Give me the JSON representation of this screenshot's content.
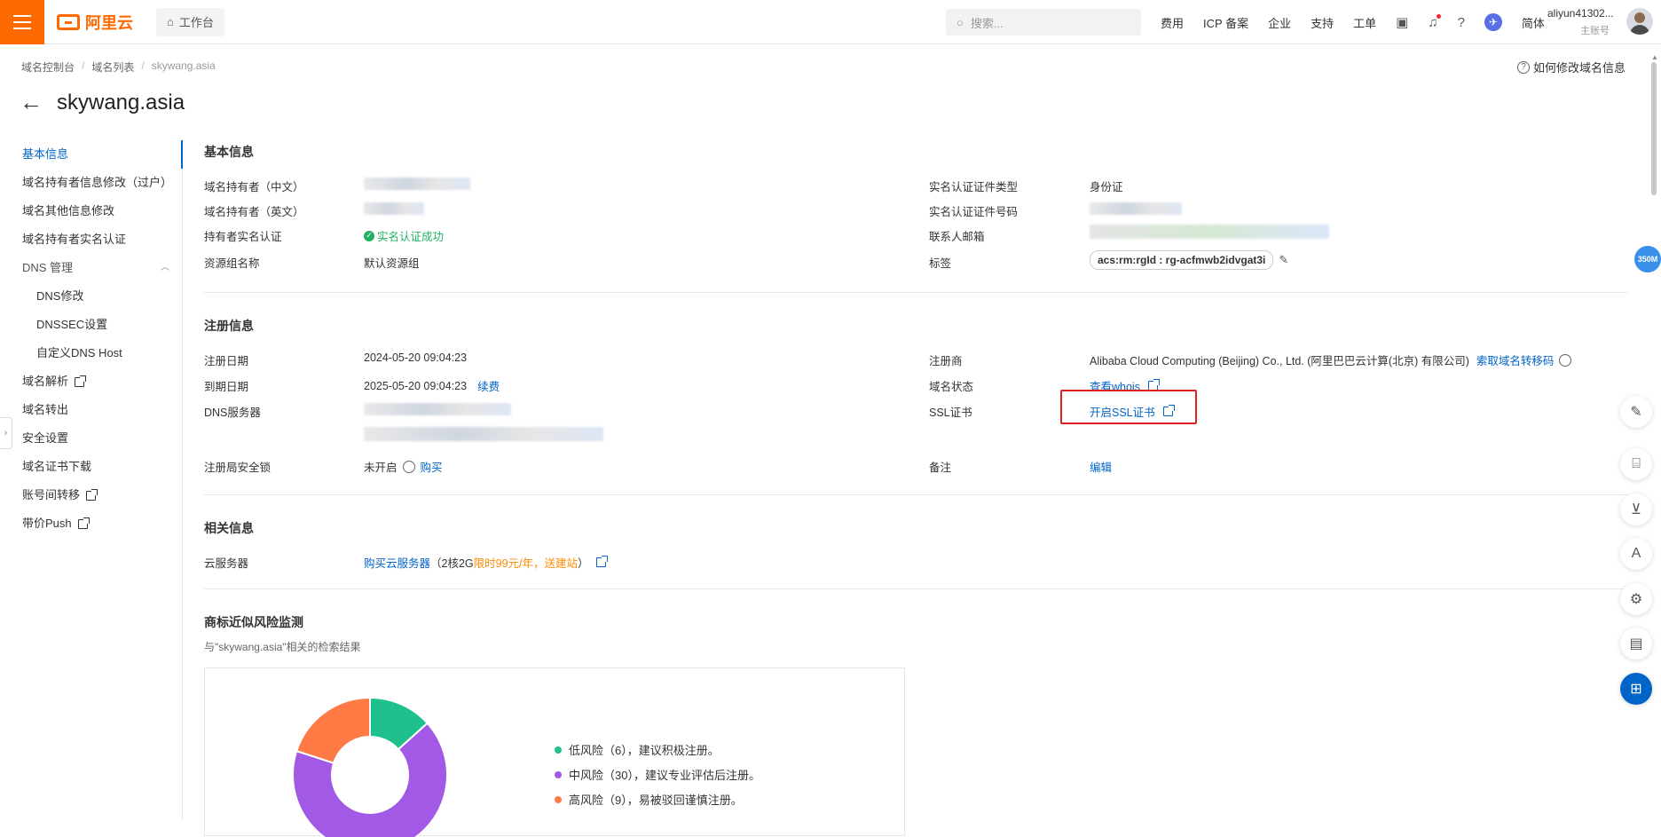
{
  "topbar": {
    "brand": "阿里云",
    "workbench_label": "工作台",
    "search_placeholder": "搜索...",
    "nav": [
      "费用",
      "ICP 备案",
      "企业",
      "支持",
      "工单"
    ],
    "lang_label": "简体",
    "user_name": "aliyun41302...",
    "user_role": "主账号",
    "lang_icon_glyph": "✈"
  },
  "breadcrumb": [
    "域名控制台",
    "域名列表",
    "skywang.asia"
  ],
  "help_link": "如何修改域名信息",
  "page_title": "skywang.asia",
  "sidenav": {
    "items": [
      {
        "label": "基本信息"
      },
      {
        "label": "域名持有者信息修改（过户）"
      },
      {
        "label": "域名其他信息修改"
      },
      {
        "label": "域名持有者实名认证"
      },
      {
        "label": "DNS 管理"
      },
      {
        "label": "DNS修改"
      },
      {
        "label": "DNSSEC设置"
      },
      {
        "label": "自定义DNS Host"
      },
      {
        "label": "域名解析"
      },
      {
        "label": "域名转出"
      },
      {
        "label": "安全设置"
      },
      {
        "label": "域名证书下载"
      },
      {
        "label": "账号间转移"
      },
      {
        "label": "带价Push"
      }
    ]
  },
  "basic": {
    "title": "基本信息",
    "holder_cn_label": "域名持有者（中文）",
    "holder_en_label": "域名持有者（英文）",
    "holder_verify_label": "持有者实名认证",
    "holder_verify_value": "实名认证成功",
    "resource_group_label": "资源组名称",
    "resource_group_value": "默认资源组",
    "cert_type_label": "实名认证证件类型",
    "cert_type_value": "身份证",
    "cert_no_label": "实名认证证件号码",
    "email_label": "联系人邮箱",
    "tag_label": "标签",
    "tag_value": "acs:rm:rgId : rg-acfmwb2idvgat3i"
  },
  "registration": {
    "title": "注册信息",
    "reg_date_label": "注册日期",
    "reg_date_value": "2024-05-20 09:04:23",
    "exp_date_label": "到期日期",
    "exp_date_value": "2025-05-20 09:04:23",
    "renew_link": "续费",
    "dns_label": "DNS服务器",
    "lock_label": "注册局安全锁",
    "lock_value": "未开启",
    "lock_buy": "购买",
    "registrar_label": "注册商",
    "registrar_value": "Alibaba Cloud Computing (Beijing) Co., Ltd. (阿里巴巴云计算(北京) 有限公司)",
    "transfer_code_link": "索取域名转移码",
    "status_label": "域名状态",
    "status_link": "查看whois",
    "ssl_label": "SSL证书",
    "ssl_link": "开启SSL证书",
    "remark_label": "备注",
    "remark_link": "编辑"
  },
  "related": {
    "title": "相关信息",
    "server_label": "云服务器",
    "server_link": "购买云服务器",
    "server_note_prefix": "（2核2G",
    "server_note_promo": "限时99元/年，送建站",
    "server_note_suffix": "）"
  },
  "trademark": {
    "title": "商标近似风险监测",
    "subtitle": "与\"skywang.asia\"相关的检索结果",
    "legend": [
      {
        "label": "低风险（6），建议积极注册。",
        "color": "#1fc08e"
      },
      {
        "label": "中风险（30），建议专业评估后注册。",
        "color": "#a259e6"
      },
      {
        "label": "高风险（9），易被驳回谨慎注册。",
        "color": "#ff7a45"
      }
    ]
  },
  "chart_data": {
    "type": "pie",
    "categories": [
      "低风险",
      "中风险",
      "高风险"
    ],
    "values": [
      6,
      30,
      9
    ],
    "colors": [
      "#1fc08e",
      "#a259e6",
      "#ff7a45"
    ]
  },
  "speed_badge": "350M"
}
